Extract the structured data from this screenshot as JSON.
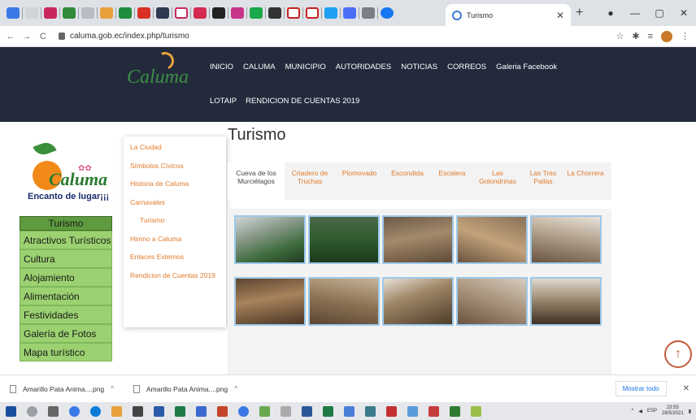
{
  "browser": {
    "active_tab_title": "Turismo",
    "address": "caluma.gob.ec/index.php/turismo"
  },
  "site": {
    "logo_text": "Caluma",
    "menu_row1": [
      "INICIO",
      "CALUMA",
      "MUNICIPIO",
      "AUTORIDADES",
      "NOTICIAS",
      "CORREOS",
      "Galeria Facebook"
    ],
    "menu_row2": [
      "LOTAIP",
      "RENDICION DE CUENTAS 2019"
    ]
  },
  "brand": {
    "name": "Caluma",
    "tagline": "Encanto de lugar¡¡¡"
  },
  "sidebar": {
    "heading": "Turismo",
    "items": [
      "Atractivos Turísticos",
      "Cultura",
      "Alojamiento",
      "Alimentación",
      "Festividades",
      "Galería de Fotos",
      "Mapa turístico"
    ]
  },
  "dropdown": {
    "items": [
      "La Ciudad",
      "Símbolos Cívicos",
      "Historia de Caluma",
      "Carnavales",
      "Turismo",
      "Himno a Caluma",
      "Enlaces Externos",
      "Rendicion de Cuentas 2019"
    ]
  },
  "page": {
    "title": "Turismo",
    "tabs": [
      "Cueva de los Murciélagos",
      "Criadero de Truchas",
      "Plomovado",
      "Escondida",
      "Escalera",
      "Las Golondrinas",
      "Las Tres Pailas",
      "La Chorrera"
    ]
  },
  "downloads": {
    "items": [
      "Amarillo Pata Anima....png",
      "Amarillo Pata Anima....png"
    ],
    "show_all": "Mostrar todo"
  },
  "taskbar": {
    "lang": "ESP",
    "time": "23:55",
    "date": "28/5/2021"
  }
}
